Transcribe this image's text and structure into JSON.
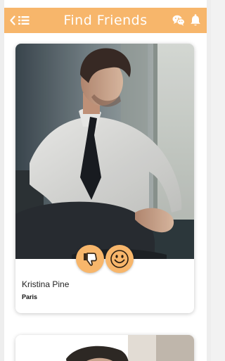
{
  "header": {
    "title": "Find Friends",
    "back_icon": "chevron-left-icon",
    "menu_icon": "list-icon",
    "chat_icon": "wechat-icon",
    "bell_icon": "bell-icon"
  },
  "colors": {
    "accent": "#f7b66b",
    "header_text": "#ffffff",
    "card_bg": "#ffffff"
  },
  "profiles": [
    {
      "name": "Kristina Pine",
      "city": "Paris",
      "photo": "man-in-shirt-and-tie-seated-by-window",
      "dislike_icon": "thumbs-down-icon",
      "like_icon": "smiley-face-icon"
    },
    {
      "photo": "portrait-partially-visible"
    }
  ]
}
